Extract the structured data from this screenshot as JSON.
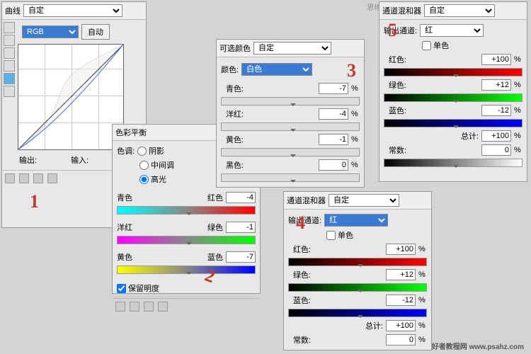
{
  "watermarks": {
    "top": "思缘设计论坛 WWW.MISSYUAN.COM",
    "bottom": "PS爱好者教程网 www.psahz.com"
  },
  "curves": {
    "title": "曲线",
    "preset": "自定",
    "channel": "RGB",
    "auto": "自动",
    "output": "输出:",
    "input": "输入:"
  },
  "colorBalance": {
    "title": "色彩平衡",
    "toneLabel": "色调:",
    "shadows": "阴影",
    "midtones": "中间调",
    "highlights": "高光",
    "cyan": "青色",
    "red": "红色",
    "magenta": "洋红",
    "green": "绿色",
    "yellow": "黄色",
    "blue": "蓝色",
    "v1": "-4",
    "v2": "-1",
    "v3": "-7",
    "preserve": "保留明度"
  },
  "selColor": {
    "title": "可选颜色",
    "preset": "自定",
    "colorsLabel": "颜色:",
    "colorSel": "白色",
    "cyan": "青色:",
    "magenta": "洋红:",
    "yellow": "黄色:",
    "black": "黑色:",
    "vC": "-7",
    "vM": "-4",
    "vY": "-1",
    "vK": "0"
  },
  "mixer4": {
    "title": "通道混和器",
    "preset": "自定",
    "outLabel": "输出通道:",
    "outCh": "红",
    "mono": "单色",
    "red": "红色:",
    "green": "绿色:",
    "blue": "蓝色:",
    "total": "总计:",
    "constant": "常数:",
    "vR": "+100",
    "vG": "+12",
    "vB": "-12",
    "vT": "+100",
    "vC": "0"
  },
  "mixer5": {
    "title": "通道混和器",
    "preset": "自定",
    "outLabel": "输出通道:",
    "outCh": "红",
    "mono": "单色",
    "red": "红色:",
    "green": "绿色:",
    "blue": "蓝色:",
    "total": "总计:",
    "constant": "常数:",
    "vR": "+100",
    "vG": "+12",
    "vB": "-12",
    "vT": "+100",
    "vC": "0"
  },
  "marks": {
    "m1": "1",
    "m2": "2",
    "m3": "3",
    "m4": "4",
    "m5": "5"
  },
  "pct": "%",
  "chart_data": null
}
